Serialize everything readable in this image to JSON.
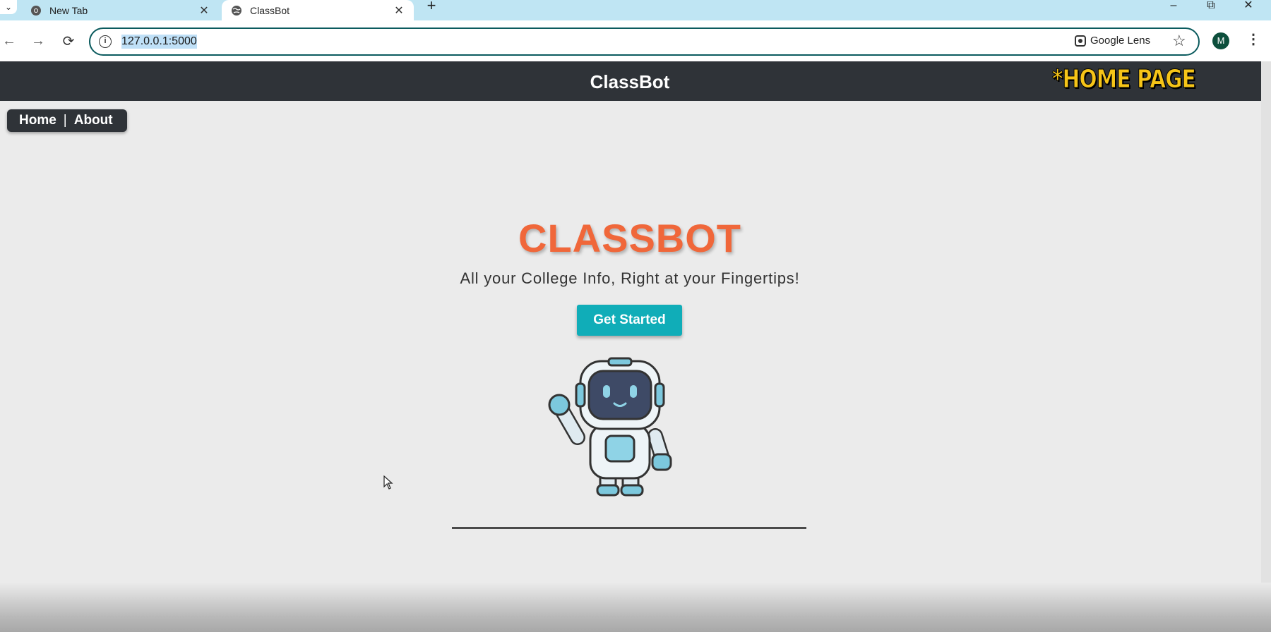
{
  "browser": {
    "tabs": [
      {
        "title": "New Tab",
        "active": false
      },
      {
        "title": "ClassBot",
        "active": true
      }
    ],
    "url": "127.0.0.1:5000",
    "lens_label": "Google Lens",
    "profile_initial": "M"
  },
  "page": {
    "brand": "ClassBot",
    "overlay_tag": "*HOME PAGE",
    "nav": {
      "home": "Home",
      "separator": "|",
      "about": "About"
    },
    "hero": {
      "title": "CLASSBOT",
      "subtitle": "All your College Info, Right at your Fingertips!",
      "cta_label": "Get Started"
    }
  },
  "colors": {
    "header_bg": "#2f3338",
    "title_orange": "#f0673a",
    "cta_teal": "#10adb8",
    "overlay_yellow": "#f6c518",
    "tabstrip": "#bfe5f3"
  }
}
